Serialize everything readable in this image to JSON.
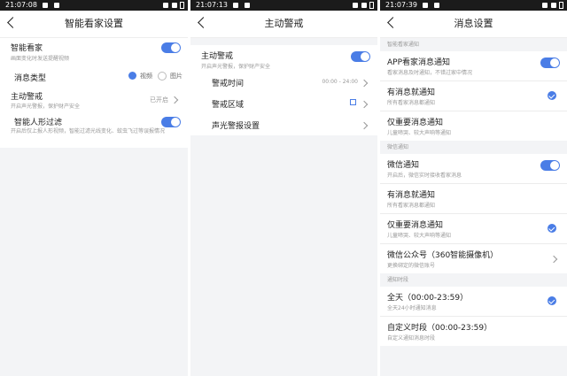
{
  "accent": "#4a7de6",
  "panel1": {
    "time": "21:07:08",
    "title": "智能看家设置",
    "smart": {
      "title": "智能看家",
      "subtitle": "画面变化时发送提醒视频"
    },
    "msgtype": {
      "label": "消息类型",
      "opt_video": "视频",
      "opt_image": "图片"
    },
    "active": {
      "title": "主动警戒",
      "subtitle": "开启声光警报，保护财产安全",
      "value": "已开启"
    },
    "human": {
      "title": "智能人形过滤",
      "subtitle": "开启后仅上报人形视频，智能过滤光线变化、蚊虫飞过等误报情况"
    }
  },
  "panel2": {
    "time": "21:07:13",
    "title": "主动警戒",
    "active": {
      "title": "主动警戒",
      "subtitle": "开启声光警报，保护财产安全"
    },
    "time_row": {
      "label": "警戒时间",
      "value": "00:00 - 24:00"
    },
    "zone": {
      "label": "警戒区域"
    },
    "sound": {
      "label": "声光警报设置"
    }
  },
  "panel3": {
    "time": "21:07:39",
    "title": "消息设置",
    "sec_home": "智能看家通知",
    "app_notify": {
      "title": "APP看家消息通知",
      "subtitle": "看家消息及时通知，不错过家中情况"
    },
    "app_any": {
      "title": "有消息就通知",
      "subtitle": "所有看家消息都通知"
    },
    "app_important": {
      "title": "仅重要消息通知",
      "subtitle": "儿童啼哭、较大声响等通知"
    },
    "sec_wechat": "微信通知",
    "wx_notify": {
      "title": "微信通知",
      "subtitle": "开启后，微信实时接收看家消息"
    },
    "wx_any": {
      "title": "有消息就通知",
      "subtitle": "所有看家消息都通知"
    },
    "wx_important": {
      "title": "仅重要消息通知",
      "subtitle": "儿童啼哭、较大声响等通知"
    },
    "wx_official": {
      "title": "微信公众号（360智能摄像机）",
      "subtitle": "更换绑定的微信账号"
    },
    "sec_time": "通知时段",
    "allday": {
      "title": "全天（00:00-23:59）",
      "subtitle": "全天24小时通知消息"
    },
    "custom": {
      "title": "自定义时段（00:00-23:59）",
      "subtitle": "自定义通知消息时段"
    }
  }
}
